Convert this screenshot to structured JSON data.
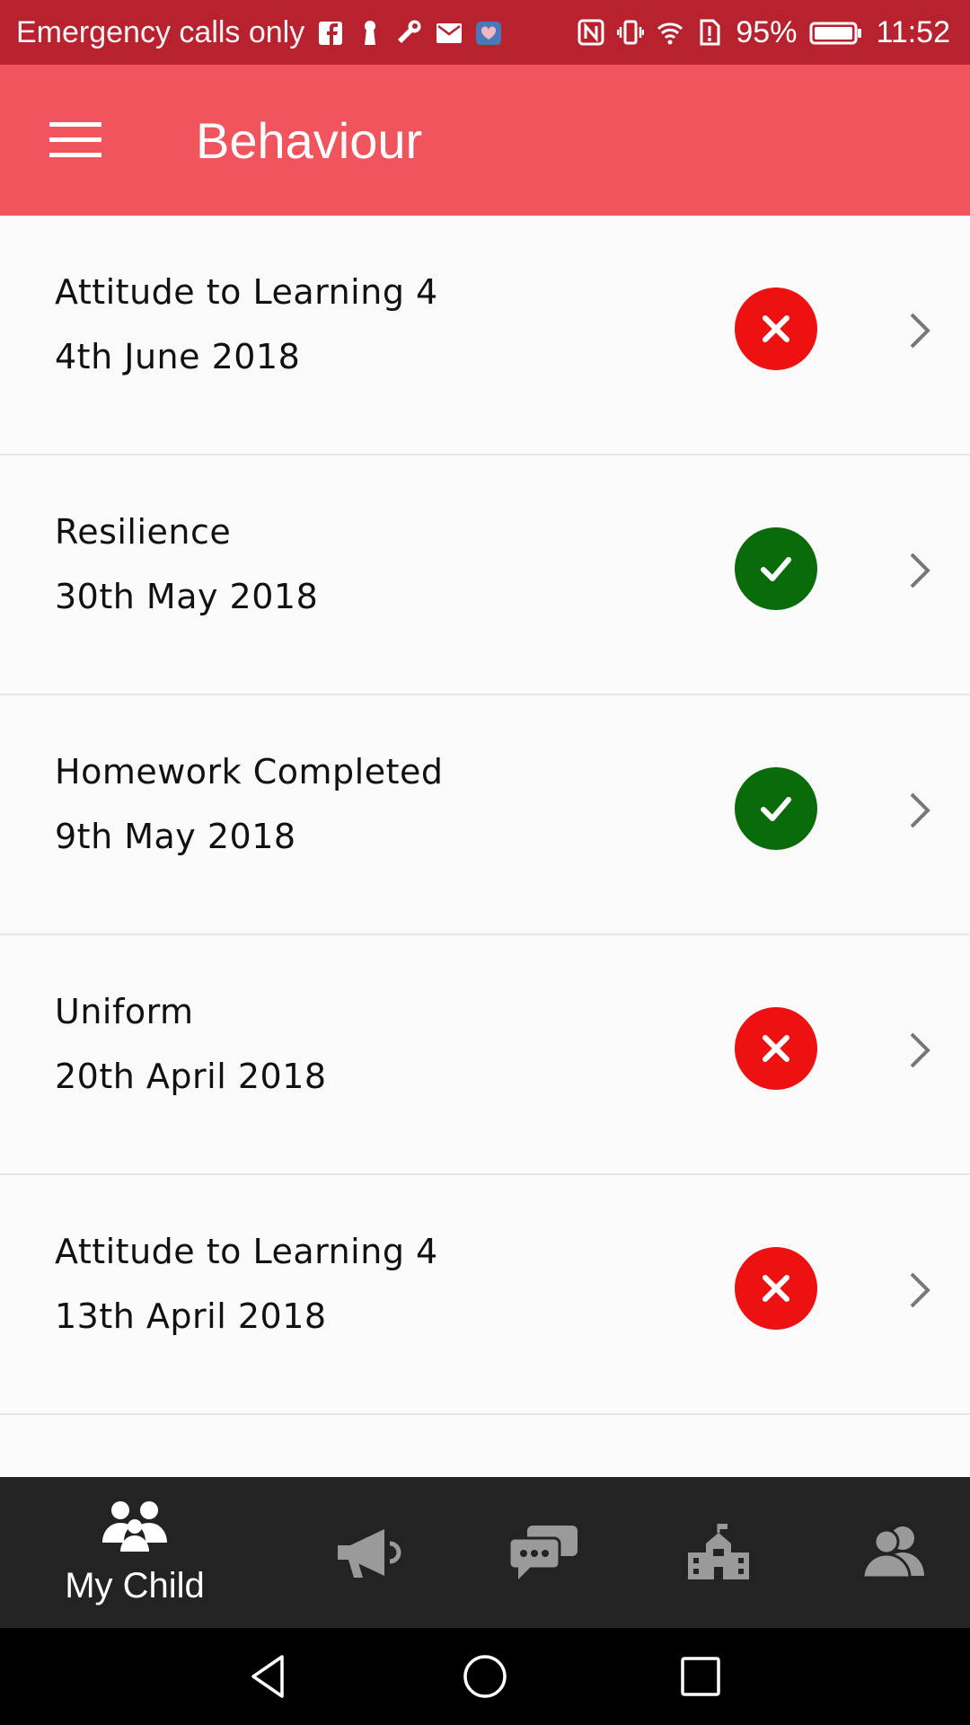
{
  "status_bar": {
    "carrier": "Emergency calls only",
    "battery": "95%",
    "time": "11:52"
  },
  "app_bar": {
    "title": "Behaviour"
  },
  "colors": {
    "status_bar": "#b8222e",
    "app_bar": "#f0545c",
    "negative": "#ee1111",
    "positive": "#0a6b0a",
    "bottom_nav": "#232323"
  },
  "behaviour_items": [
    {
      "title": "Attitude to Learning 4",
      "date": "4th June 2018",
      "status": "negative",
      "icon": "x-icon"
    },
    {
      "title": "Resilience",
      "date": "30th May 2018",
      "status": "positive",
      "icon": "check-icon"
    },
    {
      "title": "Homework Completed",
      "date": "9th May 2018",
      "status": "positive",
      "icon": "check-icon"
    },
    {
      "title": "Uniform",
      "date": "20th April 2018",
      "status": "negative",
      "icon": "x-icon"
    },
    {
      "title": "Attitude to Learning 4",
      "date": "13th April 2018",
      "status": "negative",
      "icon": "x-icon"
    }
  ],
  "bottom_nav": {
    "items": [
      {
        "icon": "family-icon",
        "label": "My Child",
        "active": true
      },
      {
        "icon": "megaphone-icon",
        "label": ""
      },
      {
        "icon": "chat-bubbles-icon",
        "label": ""
      },
      {
        "icon": "school-icon",
        "label": ""
      },
      {
        "icon": "contacts-icon",
        "label": ""
      }
    ]
  },
  "system_nav": {
    "items": [
      "back-icon",
      "home-icon",
      "recents-icon"
    ]
  }
}
